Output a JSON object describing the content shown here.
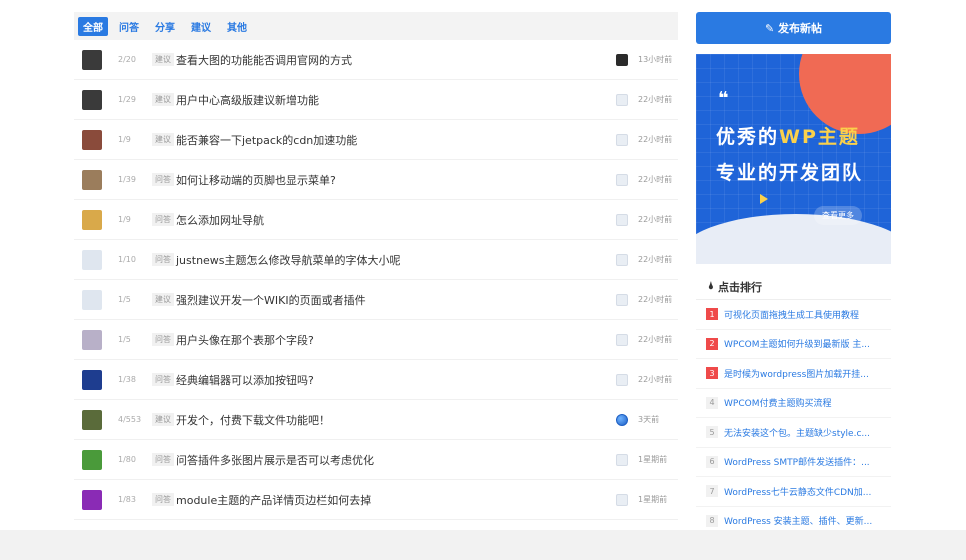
{
  "tabs": [
    "全部",
    "问答",
    "分享",
    "建议",
    "其他"
  ],
  "topics": [
    {
      "count": "2/20",
      "tag": "建议",
      "title": "查看大图的功能能否调用官网的方式",
      "time": "13小时前",
      "avatar_color": "#3a3a3a",
      "ricon": "dark"
    },
    {
      "count": "1/29",
      "tag": "建议",
      "title": "用户中心高级版建议新增功能",
      "time": "22小时前",
      "avatar_color": "#3a3a3a",
      "ricon": "light"
    },
    {
      "count": "1/9",
      "tag": "建议",
      "title": "能否兼容一下jetpack的cdn加速功能",
      "time": "22小时前",
      "avatar_color": "#8a4b3b",
      "ricon": "light"
    },
    {
      "count": "1/39",
      "tag": "问答",
      "title": "如何让移动端的页脚也显示菜单?",
      "time": "22小时前",
      "avatar_color": "#9b7d5c",
      "ricon": "light"
    },
    {
      "count": "1/9",
      "tag": "问答",
      "title": "怎么添加网址导航",
      "time": "22小时前",
      "avatar_color": "#d9a94a",
      "ricon": "light"
    },
    {
      "count": "1/10",
      "tag": "问答",
      "title": "justnews主题怎么修改导航菜单的字体大小呢",
      "time": "22小时前",
      "avatar_color": "#dfe6ef",
      "ricon": "light"
    },
    {
      "count": "1/5",
      "tag": "建议",
      "title": "强烈建议开发一个WIKI的页面或者插件",
      "time": "22小时前",
      "avatar_color": "#dfe6ef",
      "ricon": "light"
    },
    {
      "count": "1/5",
      "tag": "问答",
      "title": "用户头像在那个表那个字段?",
      "time": "22小时前",
      "avatar_color": "#b8b0c8",
      "ricon": "light"
    },
    {
      "count": "1/38",
      "tag": "问答",
      "title": "经典编辑器可以添加按钮吗?",
      "time": "22小时前",
      "avatar_color": "#1e3d8f",
      "ricon": "light"
    },
    {
      "count": "4/553",
      "tag": "建议",
      "title": "开发个，付费下载文件功能吧！",
      "time": "3天前",
      "avatar_color": "#5a6b3a",
      "ricon": "globe"
    },
    {
      "count": "1/80",
      "tag": "问答",
      "title": "问答插件多张图片展示是否可以考虑优化",
      "time": "1星期前",
      "avatar_color": "#4a9a3a",
      "ricon": "light"
    },
    {
      "count": "1/83",
      "tag": "问答",
      "title": "module主题的产品详情页边栏如何去掉",
      "time": "1星期前",
      "avatar_color": "#8a2bb5",
      "ricon": "light"
    }
  ],
  "sidebar": {
    "new_post": "✎ 发布新帖",
    "banner": {
      "quote": "❝",
      "line1_a": "优秀的",
      "line1_b": "WP主题",
      "line2": "专业的开发团队",
      "more": "查看更多"
    },
    "rank_title": "点击排行",
    "rank": [
      {
        "n": "1",
        "title": "可视化页面拖拽生成工具使用教程"
      },
      {
        "n": "2",
        "title": "WPCOM主题如何升级到最新版 主..."
      },
      {
        "n": "3",
        "title": "是时候为wordpress图片加载开挂..."
      },
      {
        "n": "4",
        "title": "WPCOM付费主题购买流程"
      },
      {
        "n": "5",
        "title": "无法安装这个包。主题缺少style.c..."
      },
      {
        "n": "6",
        "title": "WordPress SMTP邮件发送插件：..."
      },
      {
        "n": "7",
        "title": "WordPress七牛云静态文件CDN加..."
      },
      {
        "n": "8",
        "title": "WordPress 安装主题、插件、更新..."
      }
    ]
  },
  "colors": {
    "primary": "#2a7ae2",
    "accent": "#fbd14b",
    "rank_top": "#ef4a4a"
  }
}
